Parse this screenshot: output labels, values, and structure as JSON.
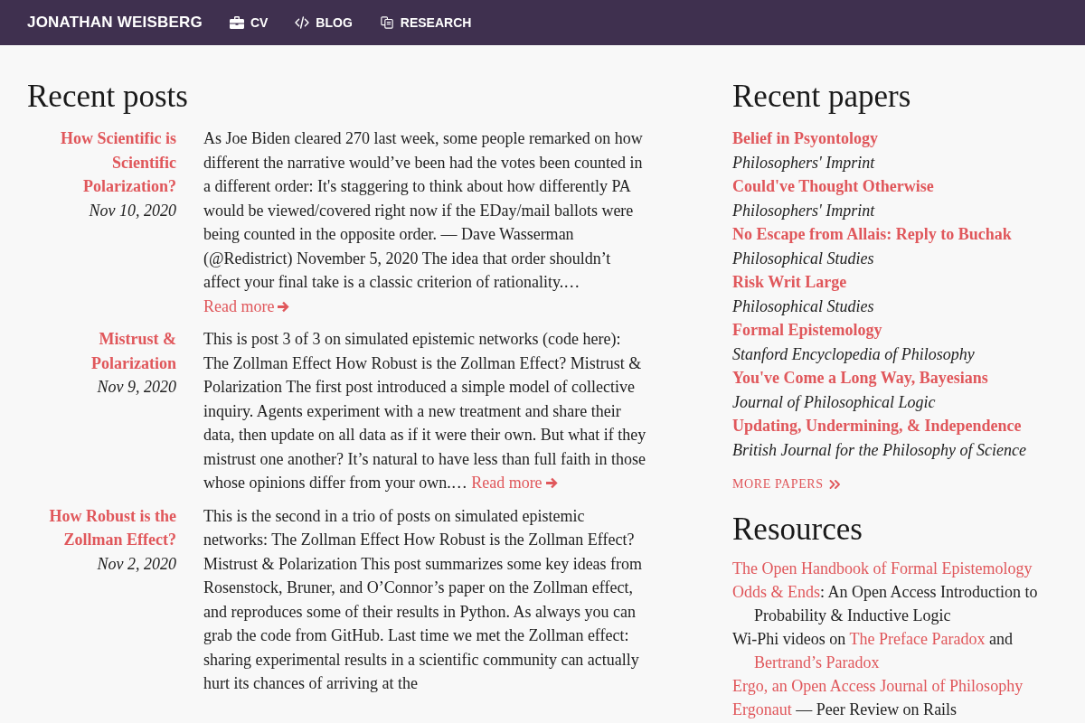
{
  "navbar": {
    "brand": "JONATHAN WEISBERG",
    "links": [
      {
        "label": "CV"
      },
      {
        "label": "BLOG"
      },
      {
        "label": "RESEARCH"
      }
    ]
  },
  "recent_posts": {
    "heading": "Recent posts",
    "posts": [
      {
        "title": "How Scientific is Scientific Polarization?",
        "date": "Nov 10, 2020",
        "excerpt": "As Joe Biden cleared 270 last week, some people remarked on how different the narrative would’ve been had the votes been counted in a different order: It's staggering to think about how differently PA would be viewed/covered right now if the EDay/mail ballots were being counted in the opposite order. — Dave Wasserman (@Redistrict) November 5, 2020 The idea that order shouldn’t affect your final take is a classic criterion of rationality.…",
        "read_more": "Read more"
      },
      {
        "title": "Mistrust & Polarization",
        "date": "Nov 9, 2020",
        "excerpt": "This is post 3 of 3 on simulated epistemic networks (code here): The Zollman Effect How Robust is the Zollman Effect? Mistrust & Polarization The first post introduced a simple model of collective inquiry. Agents experiment with a new treatment and share their data, then update on all data as if it were their own. But what if they mistrust one another? It’s natural to have less than full faith in those whose opinions differ from your own.…",
        "read_more": "Read more"
      },
      {
        "title": "How Robust is the Zollman Effect?",
        "date": "Nov 2, 2020",
        "excerpt": "This is the second in a trio of posts on simulated epistemic networks: The Zollman Effect How Robust is the Zollman Effect? Mistrust & Polarization This post summarizes some key ideas from Rosenstock, Bruner, and O’Connor’s paper on the Zollman effect, and reproduces some of their results in Python. As always you can grab the code from GitHub. Last time we met the Zollman effect: sharing experimental results in a scientific community can actually hurt its chances of arriving at the"
      }
    ]
  },
  "recent_papers": {
    "heading": "Recent papers",
    "papers": [
      {
        "title": "Belief in Psyontology",
        "venue": "Philosophers' Imprint"
      },
      {
        "title": "Could've Thought Otherwise",
        "venue": "Philosophers' Imprint"
      },
      {
        "title": "No Escape from Allais: Reply to Buchak",
        "venue": "Philosophical Studies"
      },
      {
        "title": "Risk Writ Large",
        "venue": "Philosophical Studies"
      },
      {
        "title": "Formal Epistemology",
        "venue": "Stanford Encyclopedia of Philosophy"
      },
      {
        "title": "You've Come a Long Way, Bayesians",
        "venue": "Journal of Philosophical Logic"
      },
      {
        "title": "Updating, Undermining, & Independence",
        "venue": "British Journal for the Philosophy of Science"
      }
    ],
    "more_link": "MORE PAPERS"
  },
  "resources": {
    "heading": "Resources",
    "items": [
      {
        "parts": [
          {
            "kind": "link",
            "text": "The Open Handbook of Formal Epistemology"
          }
        ]
      },
      {
        "parts": [
          {
            "kind": "link",
            "text": "Odds & Ends"
          },
          {
            "kind": "text",
            "text": ": An Open Access Introduction to Probability & Inductive Logic"
          }
        ]
      },
      {
        "parts": [
          {
            "kind": "text",
            "text": "Wi-Phi videos on "
          },
          {
            "kind": "link",
            "text": "The Preface Paradox"
          },
          {
            "kind": "text",
            "text": " and "
          },
          {
            "kind": "link",
            "text": "Bertrand’s Paradox"
          }
        ]
      },
      {
        "parts": [
          {
            "kind": "link",
            "text": "Ergo, an Open Access Journal of Philosophy"
          }
        ]
      },
      {
        "parts": [
          {
            "kind": "link",
            "text": "Ergonaut"
          },
          {
            "kind": "text",
            "text": " — Peer Review on Rails"
          }
        ]
      }
    ]
  }
}
